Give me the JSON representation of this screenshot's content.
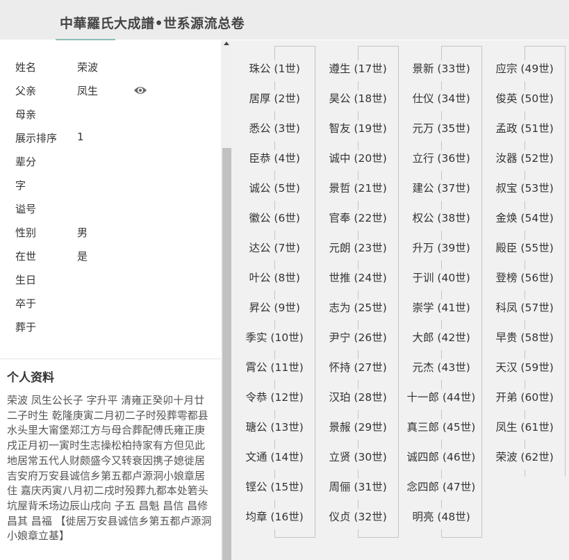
{
  "header": {
    "title": "中華羅氏大成譜•世系源流总卷"
  },
  "person": {
    "fields": [
      {
        "label": "姓名",
        "value": "荣波"
      },
      {
        "label": "父亲",
        "value": "凤生"
      },
      {
        "label": "母亲",
        "value": ""
      },
      {
        "label": "展示排序",
        "value": "1"
      },
      {
        "label": "辈分",
        "value": ""
      },
      {
        "label": "字",
        "value": ""
      },
      {
        "label": "谥号",
        "value": ""
      },
      {
        "label": "性别",
        "value": "男"
      },
      {
        "label": "在世",
        "value": "是"
      },
      {
        "label": "生日",
        "value": ""
      },
      {
        "label": "卒于",
        "value": ""
      },
      {
        "label": "葬于",
        "value": ""
      }
    ]
  },
  "profile": {
    "title": "个人资料",
    "text": "荣波 凤生公长子 字升平 清雍正癸卯十月廿二子时生 乾隆庚寅二月初二子时殁葬雩都县水头里大甯堡郑江方与母合葬配傅氏雍正庚戌正月初一寅时生志操松柏持家有方但见此地居常五代人财颇盛今又转衰因携子媳徙居吉安府万安县诚信乡第五都卢源洞小娘章居住 嘉庆丙寅八月初二戌时殁葬九都本处箬头坑屋背禾场边辰山戌向 子五 昌魁 昌信 昌修 昌其 昌福 【徙居万安县诚信乡第五都卢源洞小娘章立基】"
  },
  "generations": {
    "col1": [
      "珠公 (1世)",
      "居厚 (2世)",
      "悉公 (3世)",
      "臣恭 (4世)",
      "诚公 (5世)",
      "徽公 (6世)",
      "达公 (7世)",
      "叶公 (8世)",
      "昇公 (9世)",
      "季实 (10世)",
      "霄公 (11世)",
      "令恭 (12世)",
      "瑭公 (13世)",
      "文通 (14世)",
      "铿公 (15世)",
      "均章 (16世)"
    ],
    "col2": [
      "遵生 (17世)",
      "昊公 (18世)",
      "智友 (19世)",
      "诚中 (20世)",
      "景哲 (21世)",
      "官奉 (22世)",
      "元朗 (23世)",
      "世推 (24世)",
      "志为 (25世)",
      "尹宁 (26世)",
      "怀持 (27世)",
      "汉珀 (28世)",
      "景赧 (29世)",
      "立贤 (30世)",
      "周俪 (31世)",
      "仪贞 (32世)"
    ],
    "col3": [
      "景新 (33世)",
      "仕仪 (34世)",
      "元万 (35世)",
      "立行 (36世)",
      "建公 (37世)",
      "权公 (38世)",
      "升万 (39世)",
      "于训 (40世)",
      "崇学 (41世)",
      "大郎 (42世)",
      "元杰 (43世)",
      "十一郎 (44世)",
      "真三郎 (45世)",
      "诚四郎 (46世)",
      "念四郎 (47世)",
      "明亮 (48世)"
    ],
    "col4": [
      "应宗 (49世)",
      "俊英 (50世)",
      "孟政 (51世)",
      "汝器 (52世)",
      "叔宝 (53世)",
      "金焕 (54世)",
      "殿臣 (55世)",
      "登榜 (56世)",
      "科凤 (57世)",
      "早贵 (58世)",
      "天汉 (59世)",
      "开弟 (60世)",
      "凤生 (61世)",
      "荣波 (62世)"
    ]
  },
  "icons": {
    "view": "eye-icon",
    "scroll_up": "scroll-up-arrow-icon"
  },
  "colors": {
    "header_bg": "#ececec",
    "panel_bg": "#f1f1f1",
    "accent": "#8bbfb6"
  }
}
